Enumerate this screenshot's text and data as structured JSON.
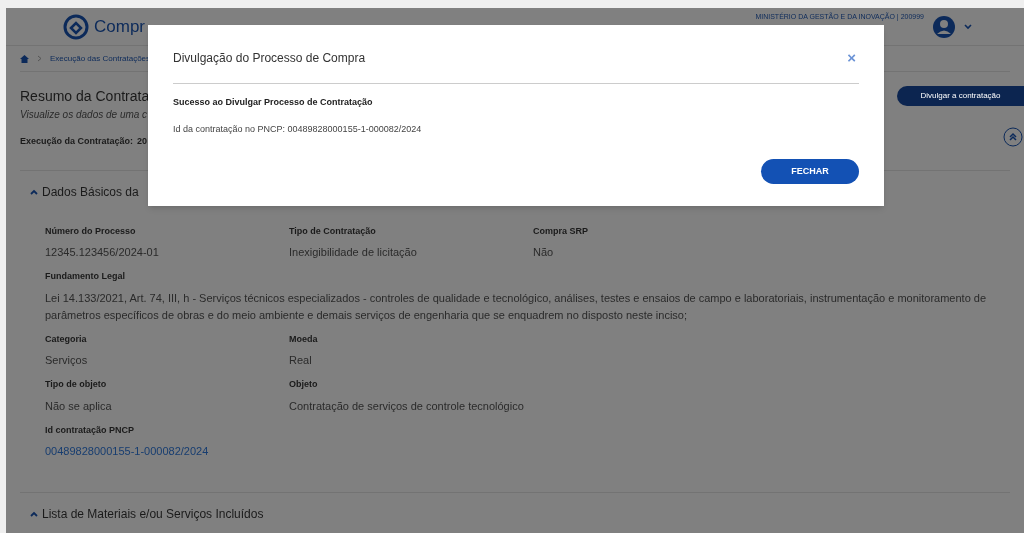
{
  "header": {
    "logo_text": "Compr",
    "org": "MINISTÉRIO DA GESTÃO E DA INOVAÇÃO | 200999"
  },
  "breadcrumb": [
    "Execução das Contratações"
  ],
  "page": {
    "title": "Resumo da Contrata",
    "subtitle": "Visualize os dados de uma c",
    "execution_label": "Execução da Contratação:",
    "execution_value": "20"
  },
  "actions": [
    {
      "label": "Divulgar a contratação"
    }
  ],
  "sections": [
    {
      "title": "Dados Básicos da",
      "expanded": true,
      "rows": [
        [
          {
            "label": "Número do Processo",
            "value": "12345.123456/2024-01",
            "kind": "text"
          },
          {
            "label": "Tipo de Contratação",
            "value": "Inexigibilidade de licitação",
            "kind": "text"
          },
          {
            "label": "Compra SRP",
            "value": "Não",
            "kind": "text"
          }
        ],
        [
          {
            "label": "Fundamento Legal",
            "value": "Lei 14.133/2021, Art. 74, III, h - Serviços técnicos especializados - controles de qualidade e tecnológico, análises, testes e ensaios de campo e laboratoriais, instrumentação e monitoramento de parâmetros específicos de obras e do meio ambiente e demais serviços de engenharia que se enquadrem no disposto neste inciso;",
            "kind": "wide"
          }
        ],
        [
          {
            "label": "Categoria",
            "value": "Serviços",
            "kind": "text"
          },
          {
            "label": "Moeda",
            "value": "Real",
            "kind": "text"
          }
        ],
        [
          {
            "label": "Tipo de objeto",
            "value": "Não se aplica",
            "kind": "text"
          },
          {
            "label": "Objeto",
            "value": "Contratação de serviços de controle tecnológico",
            "kind": "text"
          }
        ],
        [
          {
            "label": "Id contratação PNCP",
            "value": "00489828000155-1-000082/2024",
            "kind": "link"
          }
        ]
      ]
    },
    {
      "title": "Lista de Materiais e/ou Serviços Incluídos",
      "expanded": true
    }
  ],
  "modal": {
    "title": "Divulgação do Processo de Compra",
    "close": "×",
    "heading": "Sucesso ao Divulgar Processo de Contratação",
    "message": "Id da contratação no PNCP: 00489828000155-1-000082/2024",
    "button": "FECHAR"
  }
}
